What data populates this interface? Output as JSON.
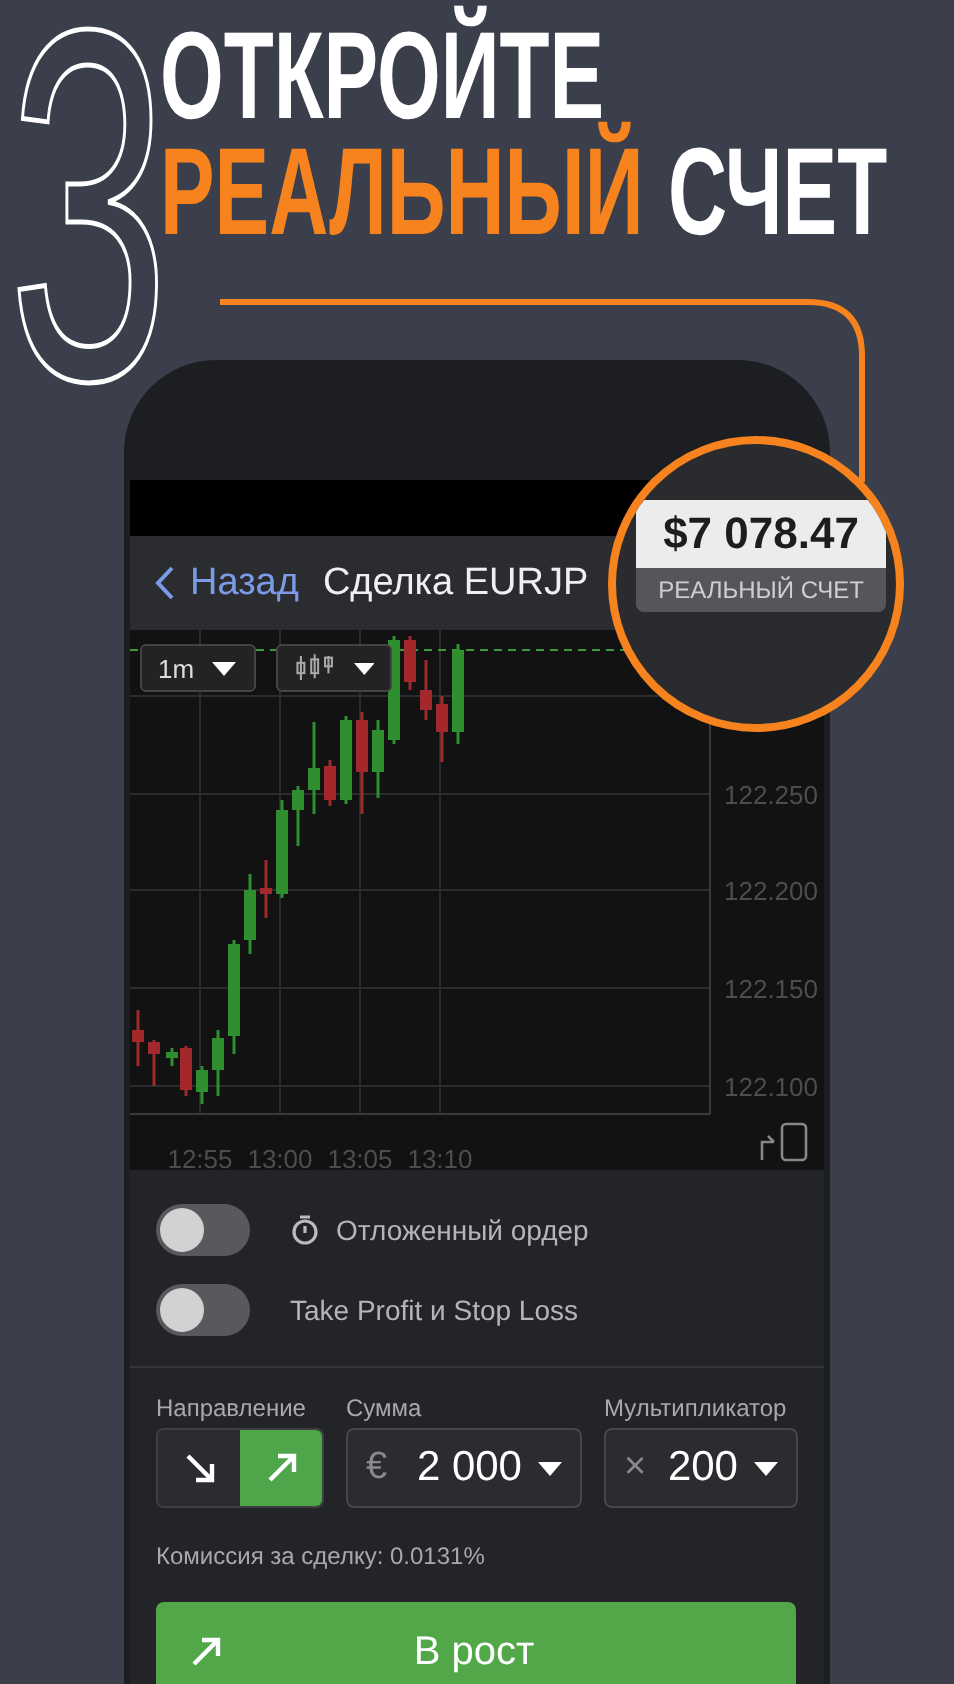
{
  "promo": {
    "step_number": "3",
    "line_1": "ОТКРОЙТЕ",
    "line_2_accent": "РЕАЛЬНЫЙ",
    "line_2_rest": "СЧЕТ"
  },
  "balance": {
    "amount": "$7 078.47",
    "account_type": "РЕАЛЬНЫЙ СЧЕТ"
  },
  "nav": {
    "back": "Назад",
    "title": "Сделка EURJP"
  },
  "chart": {
    "timeframe": "1m",
    "price_labels": [
      "122.250",
      "122.200",
      "122.150",
      "122.100"
    ],
    "time_labels": [
      "12:55",
      "13:00",
      "13:05",
      "13:10"
    ]
  },
  "options": [
    {
      "label": "Отложенный ордер",
      "on": false,
      "kind": "timer"
    },
    {
      "label": "Take Profit и Stop Loss",
      "on": false,
      "kind": "plain"
    }
  ],
  "direction": {
    "label": "Направление",
    "options": [
      {
        "kind": "down",
        "selected": false
      },
      {
        "kind": "up",
        "selected": true
      }
    ]
  },
  "amount": {
    "label": "Сумма",
    "currency": "€",
    "value": "2 000"
  },
  "multiplier": {
    "label": "Мультипликатор",
    "sign": "×",
    "value": "200"
  },
  "commission": "Комиссия за сделку: 0.0131%",
  "submit": {
    "label": "В рост"
  }
}
